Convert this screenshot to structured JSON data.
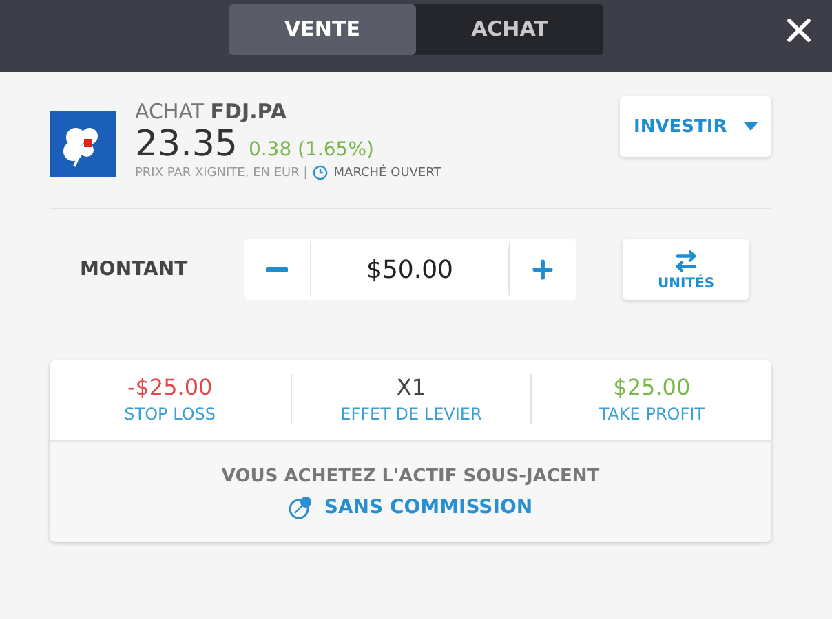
{
  "tabs": [
    {
      "label": "VENTE",
      "selected": true
    },
    {
      "label": "ACHAT",
      "selected": false
    }
  ],
  "instrument": {
    "action": "ACHAT",
    "symbol": "FDJ.PA",
    "price": "23.35",
    "change": "0.38 (1.65%)",
    "source": "PRIX PAR XIGNITE, EN EUR |",
    "market": "MARCHÉ OUVERT"
  },
  "invest_button": "INVESTIR",
  "amount": {
    "label": "MONTANT",
    "value": "$50.00",
    "units_button": "UNITÉS"
  },
  "stats": [
    {
      "value": "-$25.00",
      "label": "STOP LOSS",
      "color": "#e2474b"
    },
    {
      "value": "X1",
      "label": "EFFET DE LEVIER",
      "color": "#444444"
    },
    {
      "value": "$25.00",
      "label": "TAKE PROFIT",
      "color": "#7ab648"
    }
  ],
  "footer": {
    "text": "VOUS ACHETEZ L'ACTIF SOUS-JACENT",
    "commission": "SANS COMMISSION"
  }
}
